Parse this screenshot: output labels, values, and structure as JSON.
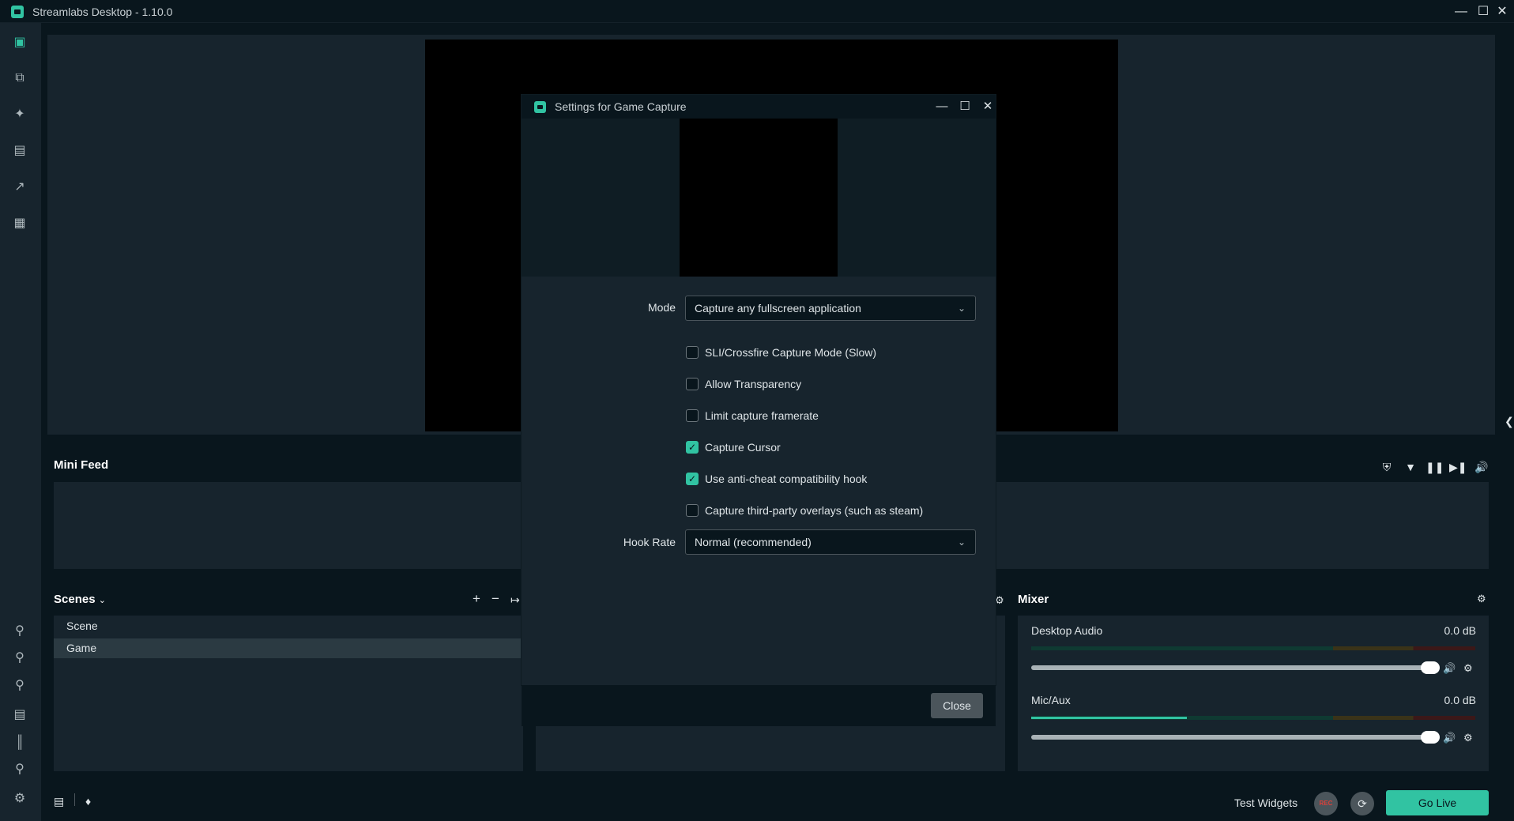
{
  "app": {
    "title": "Streamlabs Desktop - 1.10.0",
    "accent_color": "#31c3a2",
    "window_controls": [
      "minimize-icon",
      "maximize-icon",
      "close-icon"
    ]
  },
  "sidebar": {
    "icons": [
      "editor-icon",
      "layout-editor-icon",
      "themes-icon",
      "app-store-icon",
      "dashboard-icon",
      "highlighter-icon"
    ],
    "bottom_icons": [
      "app-1-icon",
      "app-2-icon",
      "app-3-icon",
      "layout-icon",
      "studio-mode-icon",
      "app-4-icon",
      "settings-icon"
    ]
  },
  "mini_feed": {
    "title": "Mini Feed",
    "controls": [
      "shield-icon",
      "filter-icon",
      "pause-icon",
      "skip-icon",
      "volume-icon"
    ]
  },
  "scenes": {
    "title": "Scenes",
    "items": [
      {
        "name": "Scene",
        "selected": false
      },
      {
        "name": "Game",
        "selected": true
      }
    ]
  },
  "mixer": {
    "title": "Mixer",
    "channels": [
      {
        "name": "Desktop Audio",
        "level_db": "0.0 dB",
        "volume": 1.0
      },
      {
        "name": "Mic/Aux",
        "level_db": "0.0 dB",
        "volume": 1.0,
        "meter": 0.35
      }
    ]
  },
  "bottom_bar": {
    "test_widgets": "Test Widgets",
    "rec_label": "REC",
    "go_live": "Go Live"
  },
  "modal": {
    "title": "Settings for Game Capture",
    "mode_label": "Mode",
    "mode_value": "Capture any fullscreen application",
    "checkboxes": [
      {
        "label": "SLI/Crossfire Capture Mode (Slow)",
        "checked": false
      },
      {
        "label": "Allow Transparency",
        "checked": false
      },
      {
        "label": "Limit capture framerate",
        "checked": false
      },
      {
        "label": "Capture Cursor",
        "checked": true
      },
      {
        "label": "Use anti-cheat compatibility hook",
        "checked": true
      },
      {
        "label": "Capture third-party overlays (such as steam)",
        "checked": false
      }
    ],
    "hook_rate_label": "Hook Rate",
    "hook_rate_value": "Normal (recommended)",
    "close_label": "Close"
  }
}
